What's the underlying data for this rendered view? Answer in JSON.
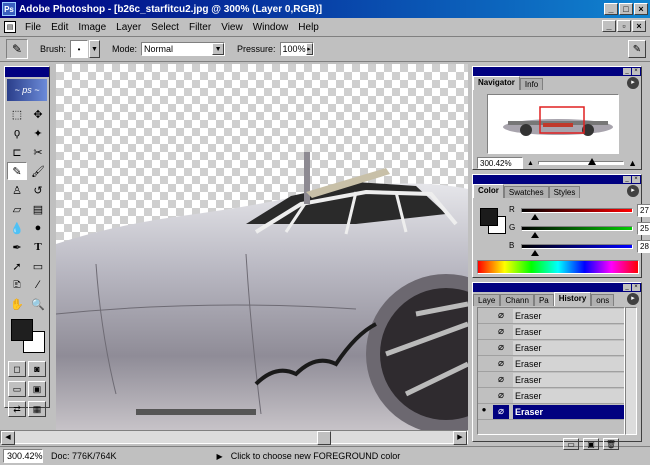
{
  "window": {
    "title": "Adobe Photoshop - [b26c_starfitcu2.jpg @ 300% (Layer 0,RGB)]",
    "icon": "photoshop-app-icon",
    "controls": [
      "minimize-icon",
      "maximize-icon",
      "close-icon"
    ]
  },
  "menu": {
    "items": [
      "File",
      "Edit",
      "Image",
      "Layer",
      "Select",
      "Filter",
      "View",
      "Window",
      "Help"
    ]
  },
  "options": {
    "brush_label": "Brush:",
    "mode_label": "Mode:",
    "mode_value": "Normal",
    "pressure_label": "Pressure:",
    "pressure_value": "100%"
  },
  "toolbox": {
    "tools": [
      "marquee-icon",
      "move-icon",
      "lasso-icon",
      "magic-wand-icon",
      "crop-icon",
      "slice-icon",
      "airbrush-icon",
      "paintbrush-icon",
      "rubber-stamp-icon",
      "history-brush-icon",
      "eraser-icon",
      "gradient-icon",
      "blur-icon",
      "dodge-icon",
      "pen-icon",
      "type-icon",
      "path-select-icon",
      "rectangle-icon",
      "notes-icon",
      "eyedropper-icon",
      "hand-icon",
      "zoom-icon"
    ],
    "active_tool": "airbrush-icon",
    "foreground_color": "#1b1b1b",
    "background_color": "#ffffff"
  },
  "navigator": {
    "tabs": [
      "Navigator",
      "Info"
    ],
    "zoom": "300.42%"
  },
  "color_palette": {
    "tabs": [
      "Color",
      "Swatches",
      "Styles"
    ],
    "r_label": "R",
    "g_label": "G",
    "b_label": "B",
    "r_value": "27",
    "g_value": "25",
    "b_value": "28"
  },
  "history": {
    "tabs": [
      "Laye",
      "Chann",
      "Pa",
      "History",
      "ons"
    ],
    "items": [
      "Eraser",
      "Eraser",
      "Eraser",
      "Eraser",
      "Eraser",
      "Eraser",
      "Eraser"
    ],
    "selected_index": 6
  },
  "status": {
    "zoom": "300.42%",
    "doc": "Doc: 776K/764K",
    "hint": "Click to choose new FOREGROUND color"
  }
}
